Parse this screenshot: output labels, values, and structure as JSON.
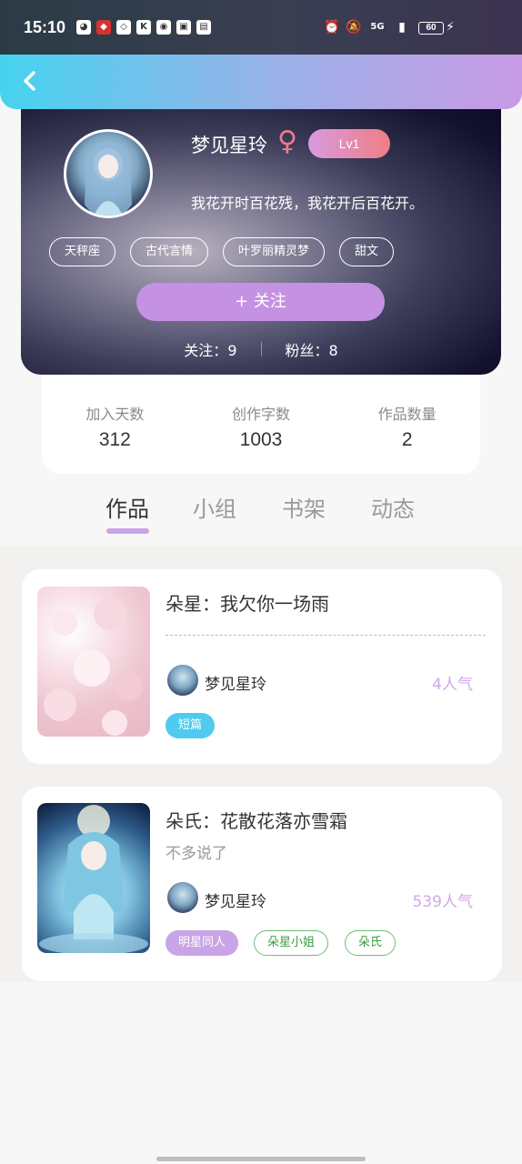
{
  "status_bar": {
    "time": "15:10",
    "left_icons": [
      "qq-icon",
      "app-icon",
      "app-icon",
      "app-icon",
      "weibo-icon",
      "iqiyi-icon",
      "app-icon"
    ],
    "network": "5G",
    "battery": "60"
  },
  "profile": {
    "nickname": "梦见星玲",
    "gender_symbol": "♀",
    "level": "Lv1",
    "bio": "我花开时百花残，我花开后百花开。",
    "tags": [
      "天秤座",
      "古代言情",
      "叶罗丽精灵梦",
      "甜文"
    ],
    "follow_button": "+ 关注",
    "following_label": "关注：",
    "following_count": "9",
    "fans_label": "粉丝：",
    "fans_count": "8"
  },
  "stats": [
    {
      "label": "加入天数",
      "value": "312"
    },
    {
      "label": "创作字数",
      "value": "1003"
    },
    {
      "label": "作品数量",
      "value": "2"
    }
  ],
  "tabs": [
    {
      "label": "作品",
      "active": true
    },
    {
      "label": "小组",
      "active": false
    },
    {
      "label": "书架",
      "active": false
    },
    {
      "label": "动态",
      "active": false
    }
  ],
  "works": [
    {
      "title": "朵星：我欠你一场雨",
      "description": "",
      "author": "梦见星玲",
      "popularity": "4人气",
      "tags": [
        {
          "text": "短篇",
          "style": "blue"
        }
      ]
    },
    {
      "title": "朵氏：花散花落亦雪霜",
      "description": "不多说了",
      "author": "梦见星玲",
      "popularity": "539人气",
      "tags": [
        {
          "text": "明星同人",
          "style": "purple"
        },
        {
          "text": "朵星小姐",
          "style": "outline"
        },
        {
          "text": "朵氏",
          "style": "outline"
        }
      ]
    }
  ],
  "colors": {
    "accent_purple": "#c592e3",
    "level_gradient_start": "#d79be0",
    "level_gradient_end": "#f07d84",
    "header_gradient_start": "#46d3ef",
    "header_gradient_end": "#c99ae6",
    "popularity": "#d2a8e8",
    "tag_blue": "#4ecbef",
    "tag_outline_green": "#6fbf73"
  }
}
